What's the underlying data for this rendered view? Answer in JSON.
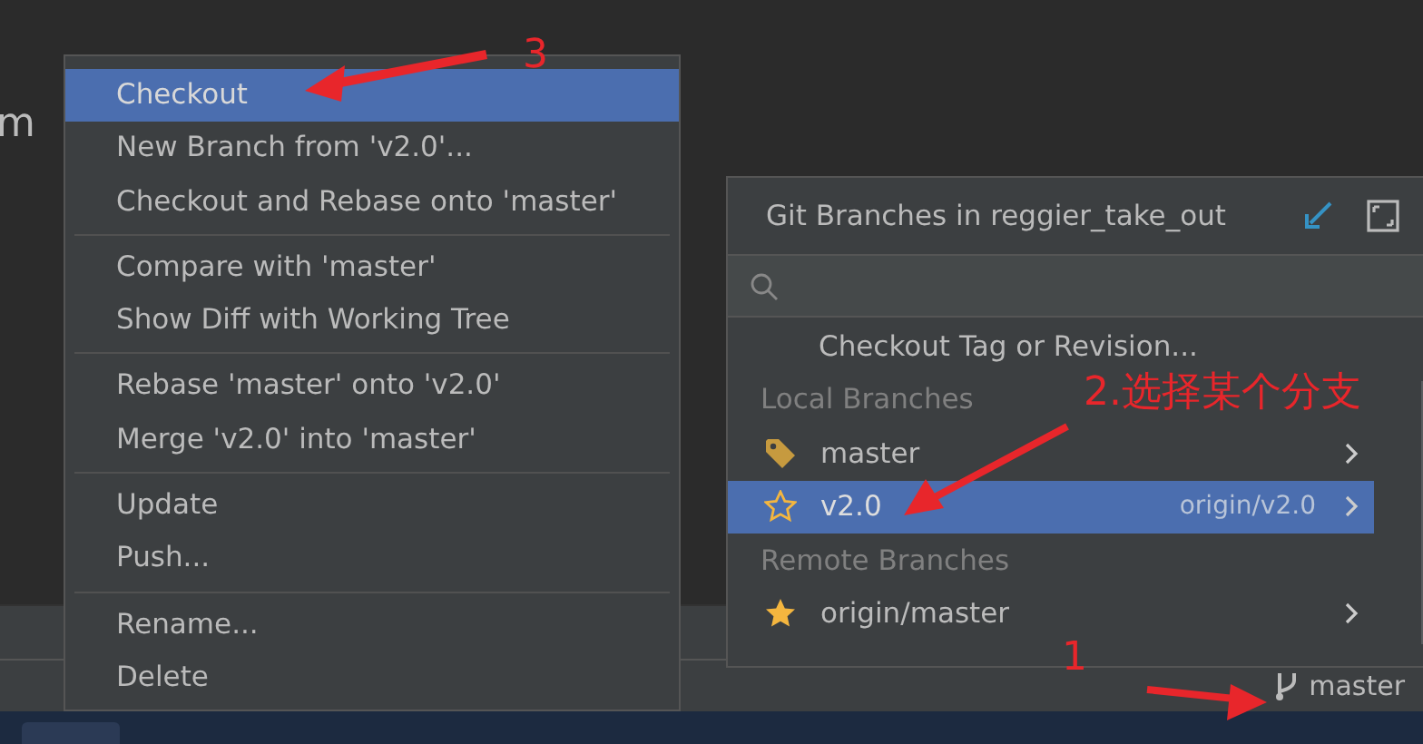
{
  "editor": {
    "text": "m"
  },
  "context_menu": {
    "groups": [
      [
        {
          "label": "Checkout",
          "selected": true
        },
        {
          "label": "New Branch from 'v2.0'...",
          "selected": false
        },
        {
          "label": "Checkout and Rebase onto 'master'",
          "selected": false
        }
      ],
      [
        {
          "label": "Compare with 'master'",
          "selected": false
        },
        {
          "label": "Show Diff with Working Tree",
          "selected": false
        }
      ],
      [
        {
          "label": "Rebase 'master' onto 'v2.0'",
          "selected": false
        },
        {
          "label": "Merge 'v2.0' into 'master'",
          "selected": false
        }
      ],
      [
        {
          "label": "Update",
          "selected": false
        },
        {
          "label": "Push...",
          "selected": false
        }
      ],
      [
        {
          "label": "Rename...",
          "selected": false
        },
        {
          "label": "Delete",
          "selected": false
        }
      ]
    ]
  },
  "branches_popup": {
    "title": "Git Branches in reggier_take_out",
    "items": [
      {
        "kind": "action",
        "label": "Checkout Tag or Revision..."
      },
      {
        "kind": "header",
        "label": "Local Branches"
      },
      {
        "kind": "current-branch",
        "label": "master",
        "selected": false
      },
      {
        "kind": "branch",
        "favorite": false,
        "label": "v2.0",
        "tracking": "origin/v2.0",
        "selected": true
      },
      {
        "kind": "header",
        "label": "Remote Branches"
      },
      {
        "kind": "branch",
        "favorite": true,
        "label": "origin/master",
        "selected": false
      }
    ]
  },
  "status_bar": {
    "branch": "master"
  },
  "annotations": [
    "3",
    "2.选择某个分支",
    "1"
  ]
}
